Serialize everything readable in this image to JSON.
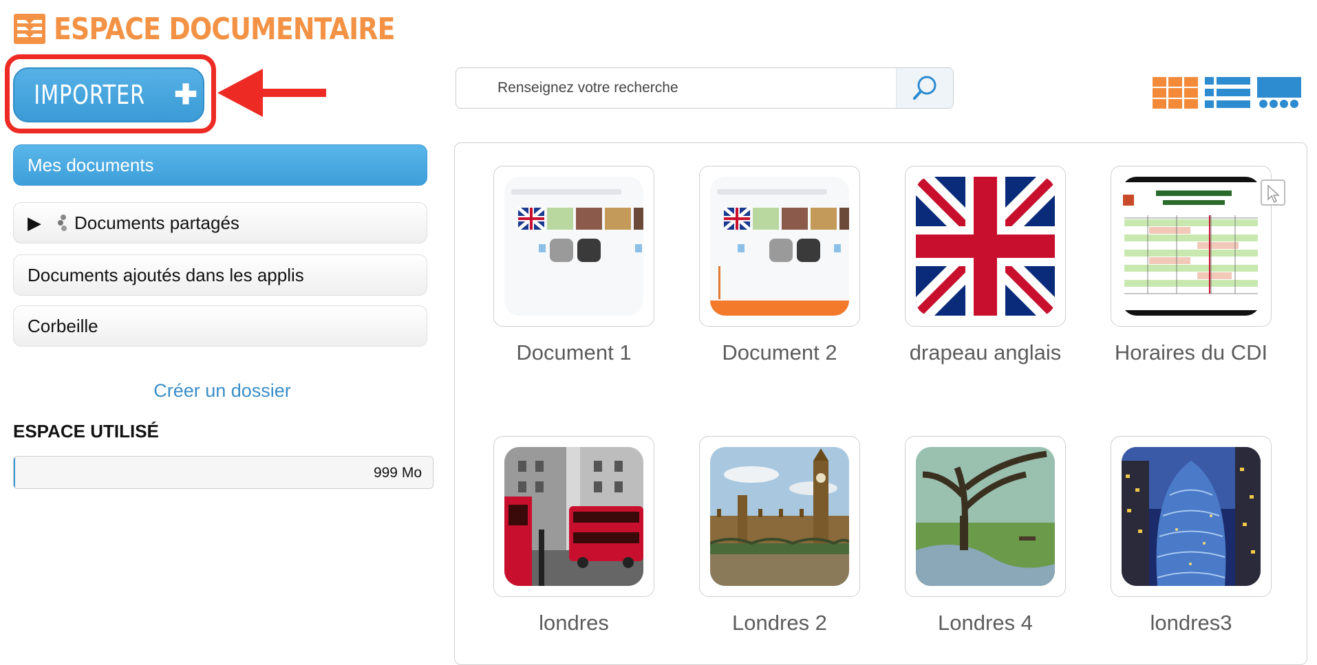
{
  "header": {
    "title": "ESPACE DOCUMENTAIRE",
    "logo_icon": "folder-stack-icon",
    "brand_color": "#f39244"
  },
  "import_button": {
    "label": "IMPORTER",
    "icon": "plus-icon"
  },
  "annotation": {
    "highlight_color": "#ee2a24",
    "arrow_icon": "red-arrow-icon"
  },
  "sidebar": {
    "items": [
      {
        "label": "Mes documents",
        "active": true
      },
      {
        "label": "Documents partagés",
        "icons": [
          "play-icon",
          "share-icon"
        ]
      },
      {
        "label": "Documents ajoutés dans les applis"
      },
      {
        "label": "Corbeille"
      }
    ],
    "create_folder": "Créer un dossier"
  },
  "storage": {
    "title": "ESPACE UTILISÉ",
    "value": "999 Mo",
    "fill_fraction": 0.002
  },
  "search": {
    "placeholder": "Renseignez votre recherche",
    "value": "",
    "icon": "search-icon"
  },
  "view_modes": [
    {
      "name": "grid-view-icon",
      "color": "#f38a3a"
    },
    {
      "name": "list-view-icon",
      "color": "#2d8bd0"
    },
    {
      "name": "carousel-view-icon",
      "color": "#2d8bd0"
    }
  ],
  "documents": [
    {
      "label": "Document 1",
      "thumbnail": "screenshot-thumbnail"
    },
    {
      "label": "Document 2",
      "thumbnail": "screenshot-thumbnail"
    },
    {
      "label": "drapeau anglais",
      "thumbnail": "union-jack-flag"
    },
    {
      "label": "Horaires du CDI",
      "thumbnail": "schedule-table"
    },
    {
      "label": "londres",
      "thumbnail": "london-street-photo"
    },
    {
      "label": "Londres 2",
      "thumbnail": "parliament-photo"
    },
    {
      "label": "Londres 4",
      "thumbnail": "park-tree-photo"
    },
    {
      "label": "londres3",
      "thumbnail": "gherkin-tower-photo"
    }
  ]
}
